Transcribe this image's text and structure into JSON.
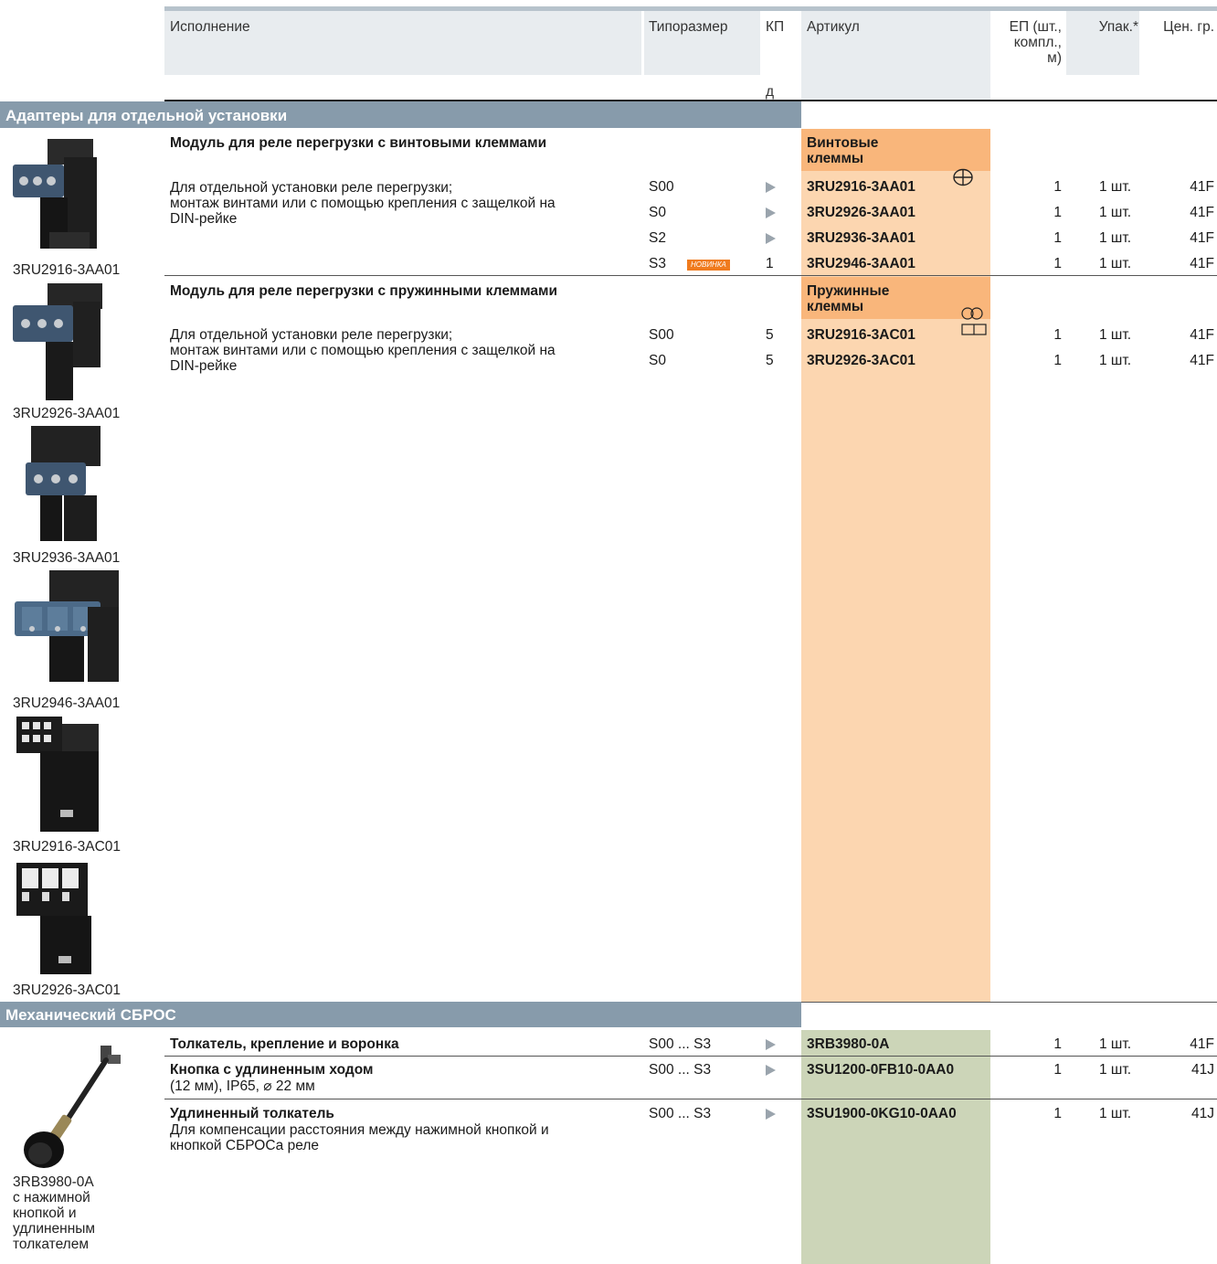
{
  "header": {
    "col_ispolnenie": "Исполнение",
    "col_tiporazmer": "Типоразмер",
    "col_kp": "КП",
    "col_kp_sub": "д",
    "col_artikul": "Артикул",
    "col_ep": [
      "ЕП (шт.,",
      "компл.,",
      "м)"
    ],
    "col_upak": "Упак.*",
    "col_tsen": "Цен. гр."
  },
  "sections": {
    "s1_title": "Адаптеры для отдельной установки",
    "s2_title": "Механический СБРОС"
  },
  "group1": {
    "title": "Модуль для реле перегрузки с винтовыми клеммами",
    "terminal_label": [
      "Винтовые",
      "клеммы"
    ],
    "desc": [
      "Для отдельной установки реле перегрузки;",
      "монтаж винтами или с помощью крепления с защелкой на",
      "DIN-рейке"
    ],
    "rows": [
      {
        "size": "S00",
        "kp": "►",
        "art": "3RU2916-3AA01",
        "ep": "1",
        "upak": "1 шт.",
        "price": "41F"
      },
      {
        "size": "S0",
        "kp": "►",
        "art": "3RU2926-3AA01",
        "ep": "1",
        "upak": "1 шт.",
        "price": "41F"
      },
      {
        "size": "S2",
        "kp": "►",
        "art": "3RU2936-3AA01",
        "ep": "1",
        "upak": "1 шт.",
        "price": "41F"
      },
      {
        "size": "S3",
        "kp": "1",
        "art": "3RU2946-3AA01",
        "ep": "1",
        "upak": "1 шт.",
        "price": "41F",
        "badge": "НОВИНКА"
      }
    ]
  },
  "group2": {
    "title": "Модуль для реле перегрузки с пружинными клеммами",
    "terminal_label": [
      "Пружинные",
      "клеммы"
    ],
    "desc": [
      "Для отдельной установки реле перегрузки;",
      "монтаж винтами или с помощью крепления с защелкой на",
      "DIN-рейке"
    ],
    "rows": [
      {
        "size": "S00",
        "kp": "5",
        "art": "3RU2916-3AC01",
        "ep": "1",
        "upak": "1 шт.",
        "price": "41F"
      },
      {
        "size": "S0",
        "kp": "5",
        "art": "3RU2926-3AC01",
        "ep": "1",
        "upak": "1 шт.",
        "price": "41F"
      }
    ]
  },
  "group3": {
    "rows": [
      {
        "title": "Толкатель, крепление и воронка",
        "desc": [],
        "size": "S00 ... S3",
        "kp": "►",
        "art": "3RB3980-0A",
        "ep": "1",
        "upak": "1 шт.",
        "price": "41F"
      },
      {
        "title": "Кнопка с удлиненным ходом",
        "desc": [
          "(12 мм), IP65, ⌀ 22 мм"
        ],
        "size": "S00 ... S3",
        "kp": "►",
        "art": "3SU1200-0FB10-0AA0",
        "ep": "1",
        "upak": "1 шт.",
        "price": "41J"
      },
      {
        "title": "Удлиненный толкатель",
        "desc": [
          "Для компенсации расстояния между нажимной кнопкой и",
          "кнопкой СБРОСа реле"
        ],
        "size": "S00 ... S3",
        "kp": "►",
        "art": "3SU1900-0KG10-0AA0",
        "ep": "1",
        "upak": "1 шт.",
        "price": "41J"
      }
    ]
  },
  "captions": {
    "c1": "3RU2916-3AA01",
    "c2": "3RU2926-3AA01",
    "c3": "3RU2936-3AA01",
    "c4": "3RU2946-3AA01",
    "c5": "3RU2916-3AC01",
    "c6": "3RU2926-3AC01",
    "c7": [
      "3RB3980-0A",
      "с нажимной",
      "кнопкой и",
      "удлиненным",
      "толкателем"
    ]
  },
  "colors": {
    "header_bg": "#e8ecef",
    "section_bar": "#879bab",
    "orange_dark": "#f9b67b",
    "orange_light": "#fcd6b0",
    "green": "#ccd5b8"
  }
}
